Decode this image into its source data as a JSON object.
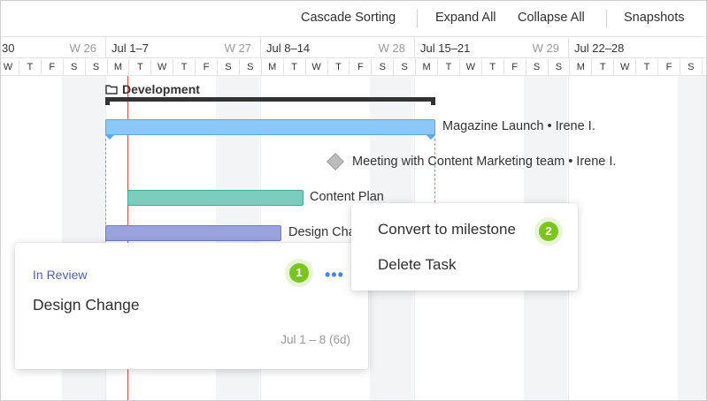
{
  "toolbar": {
    "cascade_sorting": "Cascade Sorting",
    "expand_all": "Expand All",
    "collapse_all": "Collapse All",
    "snapshots": "Snapshots"
  },
  "timeline": {
    "weeks": [
      {
        "date": "30",
        "num": ""
      },
      {
        "date": "",
        "num": "W 26"
      },
      {
        "date": "Jul 1–7",
        "num": "W 27"
      },
      {
        "date": "Jul 8–14",
        "num": "W 28"
      },
      {
        "date": "Jul 15–21",
        "num": "W 29"
      },
      {
        "date": "Jul 22–28",
        "num": ""
      }
    ],
    "days": [
      "W",
      "T",
      "F",
      "S",
      "S",
      "M",
      "T",
      "W",
      "T",
      "F",
      "S",
      "S",
      "M",
      "T",
      "W",
      "T",
      "F",
      "S",
      "S",
      "M",
      "T",
      "W",
      "T",
      "F",
      "S",
      "S",
      "M",
      "T",
      "W",
      "T",
      "F",
      "S",
      "S"
    ]
  },
  "group": {
    "label": "Development"
  },
  "tasks": {
    "magazine": "Magazine Launch • Irene I.",
    "meeting": "Meeting with Content Marketing team • Irene I.",
    "content_plan": "Content Plan",
    "design_change_short": "Design Cha"
  },
  "card": {
    "status": "In Review",
    "title": "Design Change",
    "dates": "Jul 1 – 8 (6d)",
    "more": "•••",
    "badge": "1"
  },
  "menu": {
    "convert": "Convert to milestone",
    "delete": "Delete Task",
    "badge": "2"
  },
  "colors": {
    "today_line": "#e84c4c",
    "magazine_bar": "#8cc8f7",
    "content_bar": "#7ccdbe",
    "design_bar": "#9aa3dc",
    "badge": "#7cc520",
    "status": "#4a63b5"
  }
}
